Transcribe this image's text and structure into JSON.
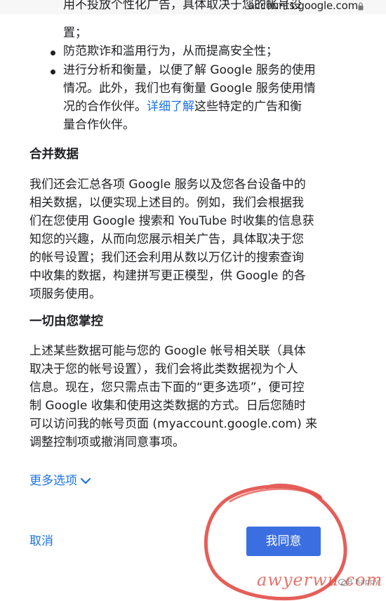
{
  "browser": {
    "url": "accounts.google.com"
  },
  "top_fragment": {
    "line1": "用不投放个性化广告，具体取决于您的帐号设",
    "line2": "置；"
  },
  "bullets": [
    {
      "lines": [
        "防范欺诈和滥用行为，从而提高安全性；"
      ]
    },
    {
      "line1": "进行分析和衡量，以便了解 Google 服务的使用",
      "line2": "情况。此外，我们也有衡量 Google 服务使用情",
      "line3_pre": "况的合作伙伴。",
      "line3_link": "详细了解",
      "line3_post": "这些特定的广告和衡",
      "line4": "量合作伙伴。"
    }
  ],
  "sections": [
    {
      "heading": "合并数据",
      "lines": [
        "我们还会汇总各项 Google 服务以及您各台设备中的",
        "相关数据，以便实现上述目的。例如，我们会根据我",
        "们在您使用 Google 搜索和 YouTube 时收集的信息获",
        "知您的兴趣，从而向您展示相关广告，具体取决于您",
        "的帐号设置；我们还会利用从数以万亿计的搜索查询",
        "中收集的数据，构建拼写更正模型，供 Google 的各",
        "项服务使用。"
      ]
    },
    {
      "heading": "一切由您掌控",
      "lines": [
        "上述某些数据可能与您的 Google 帐号相关联（具体",
        "取决于您的帐号设置），我们会将此类数据视为个人",
        "信息。现在，您只需点击下面的“更多选项”，便可控",
        "制 Google 收集和使用这类数据的方式。日后您随时",
        "可以访问我的帐号页面 (myaccount.google.com) 来",
        "调整控制项或撤消同意事项。"
      ]
    }
  ],
  "actions": {
    "more_options": "更多选项",
    "cancel": "取消",
    "agree": "我同意"
  },
  "watermark": {
    "main": "awyerwu.com",
    "side": "B happy"
  },
  "colors": {
    "link": "#1a73e8",
    "button_bg": "#3b6ee1",
    "annotation_circle": "#e24c47"
  }
}
